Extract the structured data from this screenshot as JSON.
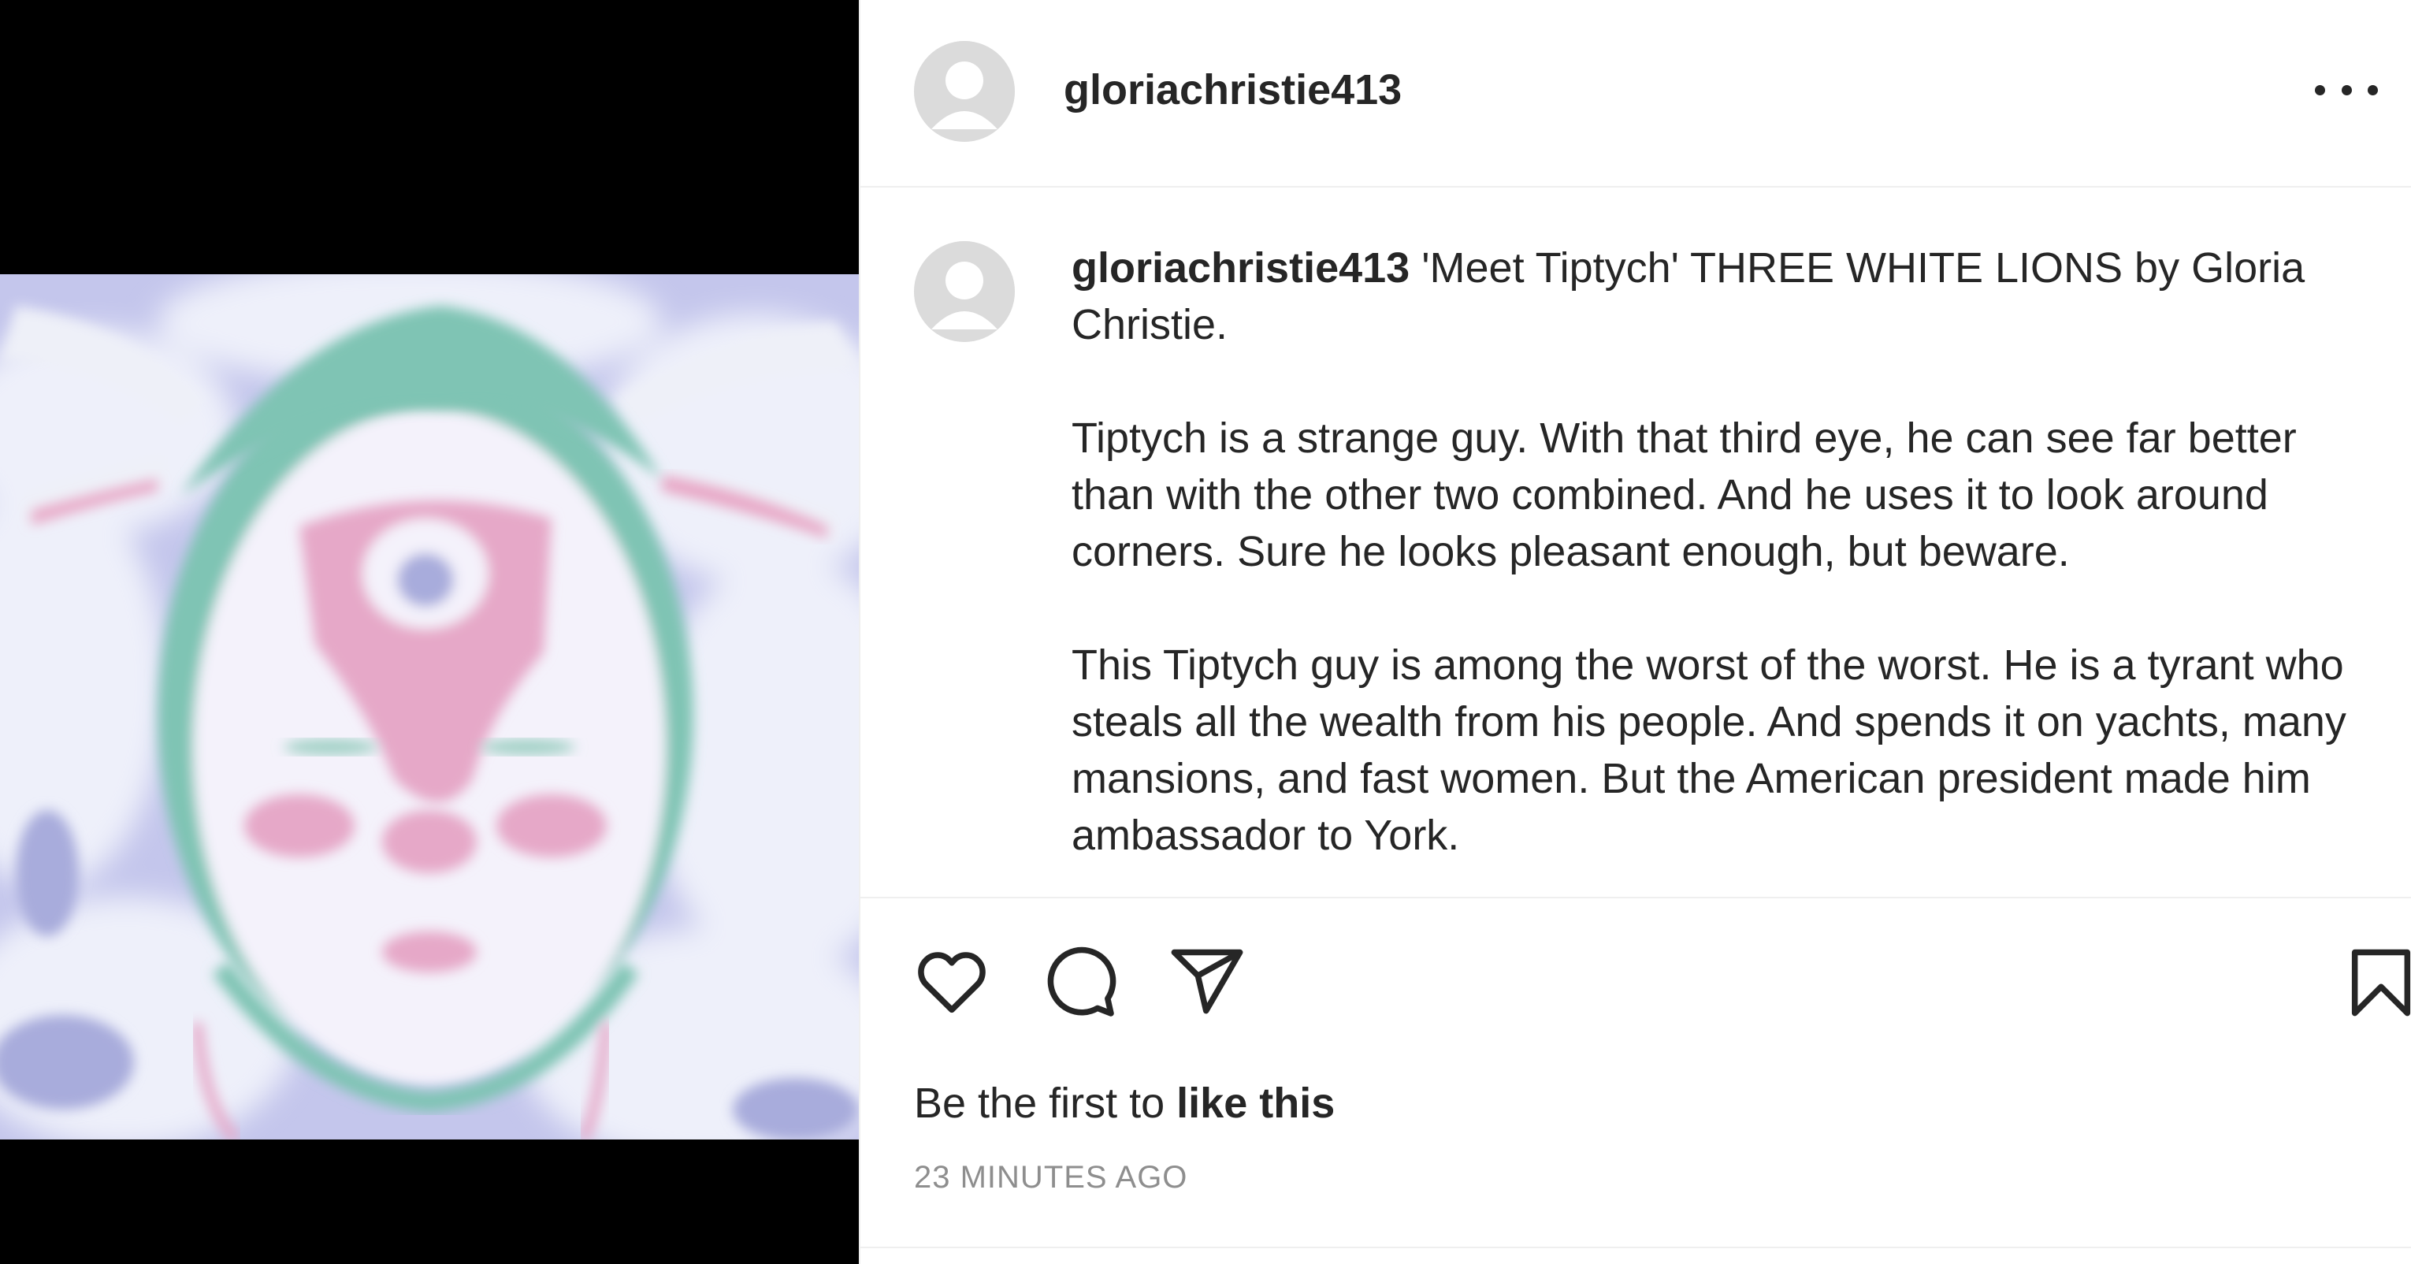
{
  "post": {
    "username": "gloriachristie413",
    "more_icon": "more-horizontal-icon",
    "caption": {
      "username": "gloriachristie413",
      "text": " 'Meet Tiptych' THREE WHITE LIONS by Gloria Christie.\n\nTiptych is a strange guy. With that third eye, he can see far better than with the other two combined. And he uses it to look around corners. Sure he looks pleasant enough, but beware.\n\nThis Tiptych guy is among the worst of the worst. He is a tyrant who steals all the wealth from his people. And spends it on yachts, many mansions, and fast women. But the American president made him ambassador to York."
    },
    "actions": {
      "like_icon": "heart-icon",
      "comment_icon": "comment-icon",
      "share_icon": "send-icon",
      "save_icon": "bookmark-icon"
    },
    "likes_prefix": "Be the first to ",
    "likes_link": "like this",
    "timestamp": "23 MINUTES AGO"
  },
  "colors": {
    "image_lavender": "#c4c6ec",
    "image_teal": "#7fc4b4",
    "image_pink": "#e6a8c8",
    "muted_text": "#8e8e8e",
    "divider": "#efefef"
  }
}
